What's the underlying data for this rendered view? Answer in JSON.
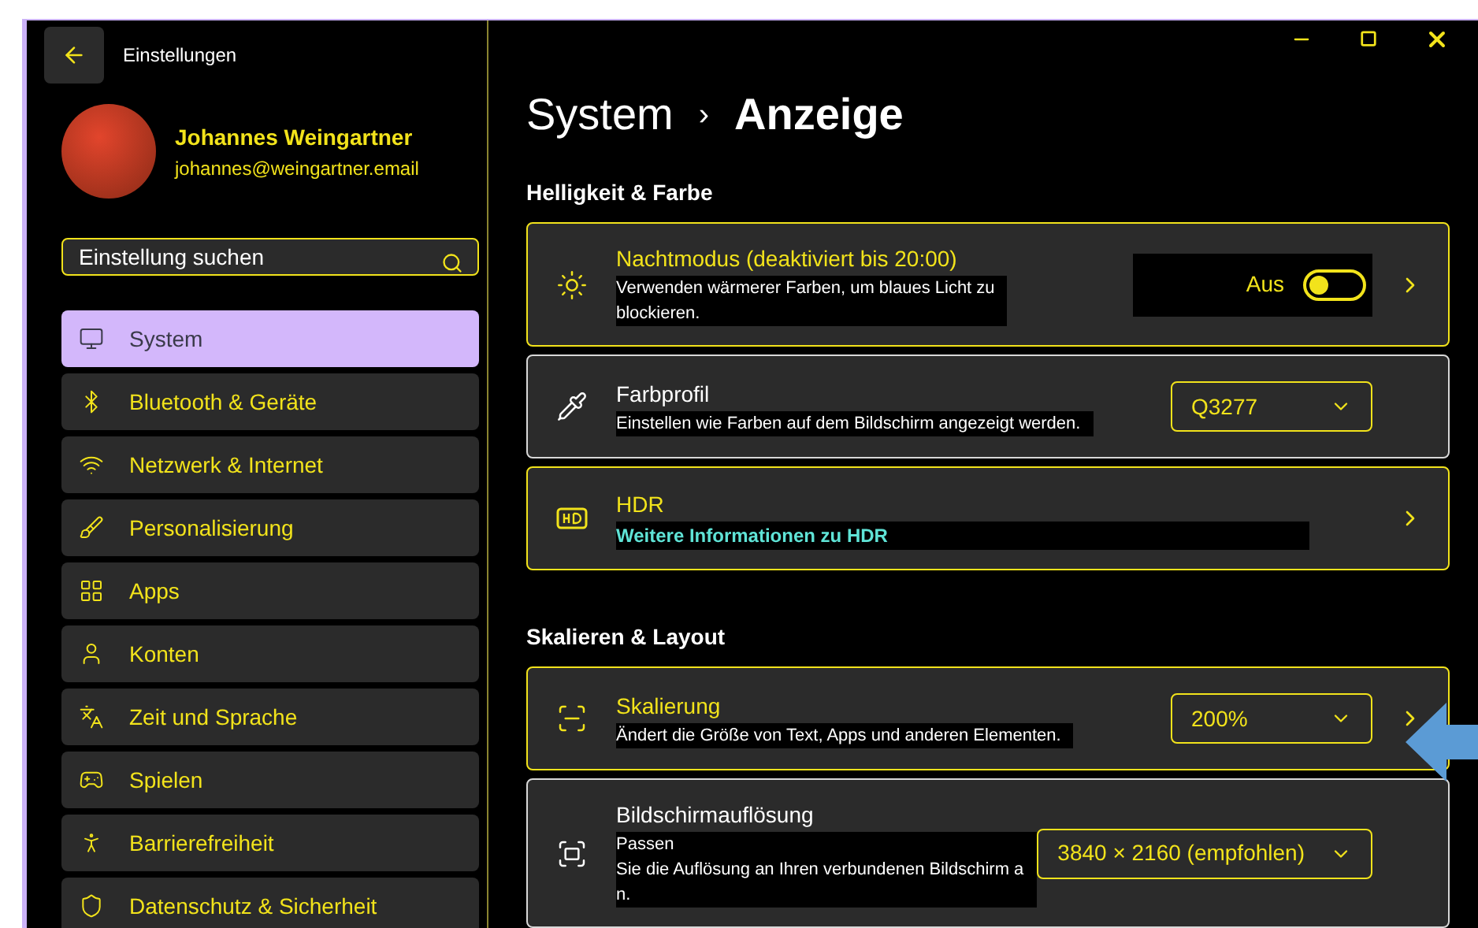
{
  "window": {
    "title": "Einstellungen"
  },
  "account": {
    "name": "Johannes Weingartner",
    "email": "johannes@weingartner.email"
  },
  "search": {
    "placeholder": "Einstellung suchen"
  },
  "nav": [
    {
      "label": "System",
      "selected": true
    },
    {
      "label": "Bluetooth & Geräte",
      "selected": false
    },
    {
      "label": "Netzwerk & Internet",
      "selected": false
    },
    {
      "label": "Personalisierung",
      "selected": false
    },
    {
      "label": "Apps",
      "selected": false
    },
    {
      "label": "Konten",
      "selected": false
    },
    {
      "label": "Zeit und Sprache",
      "selected": false
    },
    {
      "label": "Spielen",
      "selected": false
    },
    {
      "label": "Barrierefreiheit",
      "selected": false
    },
    {
      "label": "Datenschutz & Sicherheit",
      "selected": false
    }
  ],
  "breadcrumb": {
    "parent": "System",
    "separator": "›",
    "current": "Anzeige"
  },
  "sections": [
    {
      "title": "Helligkeit & Farbe",
      "cards": [
        {
          "kind": "toggle",
          "title": "Nachtmodus (deaktiviert bis 20:00)",
          "description_lines": [
            "Verwenden wärmerer Farben, um blaues Licht zu",
            "blockieren."
          ],
          "highlighted": true,
          "state_label": "Aus",
          "on": false,
          "chevron": true
        },
        {
          "kind": "dropdown",
          "title": "Farbprofil",
          "description_lines": [
            "Einstellen wie Farben auf dem Bildschirm angezeigt werden."
          ],
          "highlighted": false,
          "value": "Q3277",
          "chevron": false
        },
        {
          "kind": "link",
          "title": "HDR",
          "link": "Weitere Informationen zu HDR",
          "highlighted": true,
          "chevron": true
        }
      ]
    },
    {
      "title": "Skalieren & Layout",
      "cards": [
        {
          "kind": "dropdown",
          "title": "Skalierung",
          "description_lines": [
            "Ändert die Größe von Text, Apps und anderen Elementen."
          ],
          "highlighted": true,
          "value": "200%",
          "chevron": true
        },
        {
          "kind": "dropdown",
          "title": "Bildschirmauflösung",
          "description_lines": [
            "Passen",
            "Sie die Auflösung an Ihren verbundenen Bildschirm a",
            "n."
          ],
          "highlighted": false,
          "value": "3840 × 2160 (empfohlen)",
          "chevron": false
        }
      ]
    }
  ]
}
